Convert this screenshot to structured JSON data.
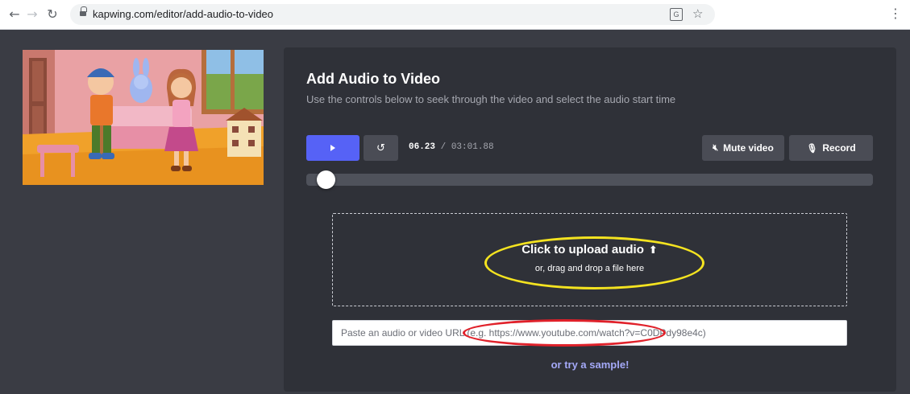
{
  "browser": {
    "url": "kapwing.com/editor/add-audio-to-video",
    "icons": [
      "back-arrow-icon",
      "forward-arrow-icon",
      "reload-icon",
      "lock-icon",
      "translate-icon",
      "star-icon",
      "kebab-menu-icon"
    ]
  },
  "editor": {
    "title": "Add Audio to Video",
    "subtitle": "Use the controls below to seek through the video and select the audio start time",
    "current_time": "06.23",
    "time_separator": " / ",
    "total_time": "03:01.88",
    "mute_label": "Mute video",
    "record_label": "Record",
    "seek_progress": 0.034,
    "accent_color": "#5662f6",
    "icons": [
      "play-icon",
      "rewind-icon",
      "mute-icon",
      "microphone-icon",
      "upload-icon"
    ]
  },
  "upload": {
    "title": "Click to upload audio",
    "subtitle": "or, drag and drop a file here",
    "url_placeholder": "Paste an audio or video URL (e.g. https://www.youtube.com/watch?v=C0DPdy98e4c)",
    "sample_link": "or try a sample!"
  },
  "annotations": {
    "highlight_upload_color": "#f4e320",
    "highlight_url_color": "#e0212a"
  }
}
